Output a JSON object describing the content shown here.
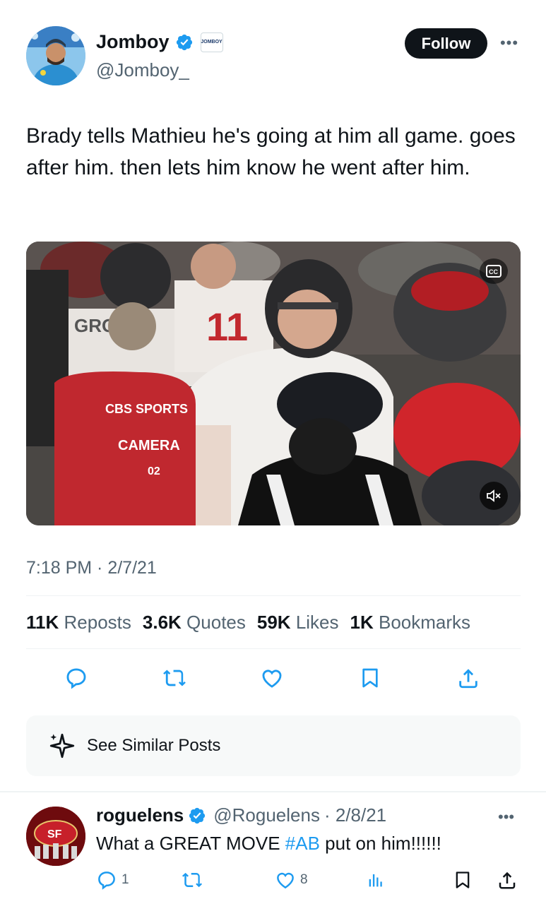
{
  "author": {
    "display_name": "Jomboy",
    "handle": "@Jomboy_",
    "affiliate_badge": "JOMBOY",
    "verified_color": "#1d9bf0"
  },
  "follow_label": "Follow",
  "more_label": "•••",
  "tweet_text": "Brady tells Mathieu he's going at him all game. goes after him. then lets him know he went after him.",
  "media": {
    "cc_label": "CC",
    "overlay_text_1": "CBS SPORTS",
    "overlay_text_2": "CAMERA",
    "overlay_text_3": "02",
    "jersey_text": "GRO      KI",
    "jersey_number": "11"
  },
  "timestamp": "7:18 PM · 2/7/21",
  "stats": [
    {
      "value": "11K",
      "label": "Reposts"
    },
    {
      "value": "3.6K",
      "label": "Quotes"
    },
    {
      "value": "59K",
      "label": "Likes"
    },
    {
      "value": "1K",
      "label": "Bookmarks"
    }
  ],
  "actions": [
    "reply-icon",
    "repost-icon",
    "like-icon",
    "bookmark-icon",
    "share-icon"
  ],
  "similar_posts_label": "See Similar Posts",
  "reply": {
    "display_name": "roguelens",
    "handle": "@Roguelens",
    "date": "· 2/8/21",
    "text_before": "What a GREAT MOVE ",
    "hashtag": "#AB",
    "text_after": " put on him!!!!!!",
    "reply_count": "1",
    "like_count": "8"
  },
  "colors": {
    "text": "#0f1419",
    "secondary": "#536471",
    "accent": "#1d9bf0",
    "divider": "#eff3f4"
  }
}
